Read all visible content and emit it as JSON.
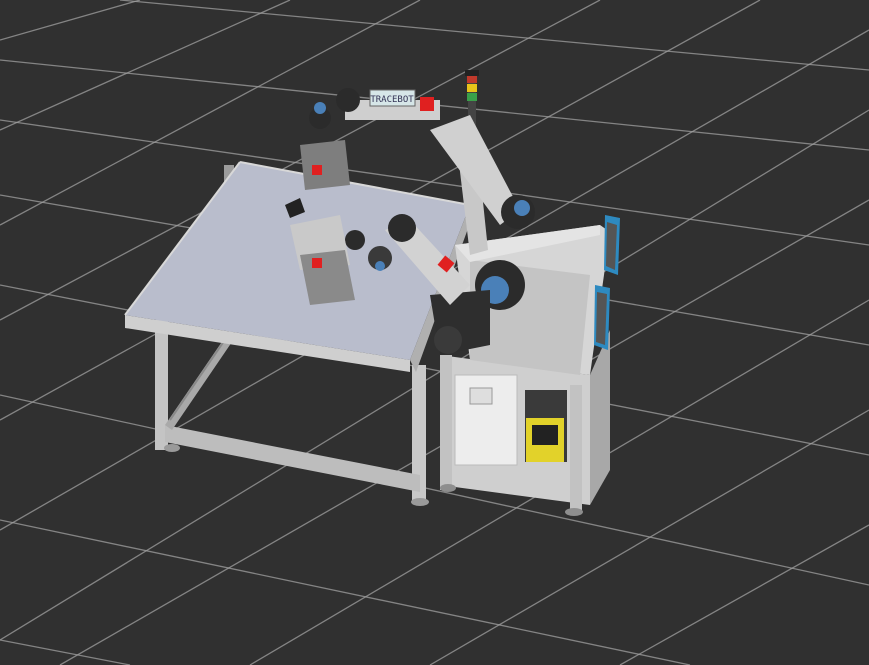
{
  "viewer": {
    "background_color": "#303030",
    "grid_color": "#a0a0a0"
  },
  "scene": {
    "robot_label": "TRACEBOT",
    "stack_light_colors": [
      "#c0392b",
      "#e8c31a",
      "#3aa04a"
    ],
    "robot_joint_color": "#4a80b8",
    "table_top_color": "#b9bdcc",
    "frame_color": "#c9c9c9",
    "cabinet_color": "#d6d6d6",
    "accent_red": "#e02020",
    "accent_yellow": "#e2d22a"
  }
}
